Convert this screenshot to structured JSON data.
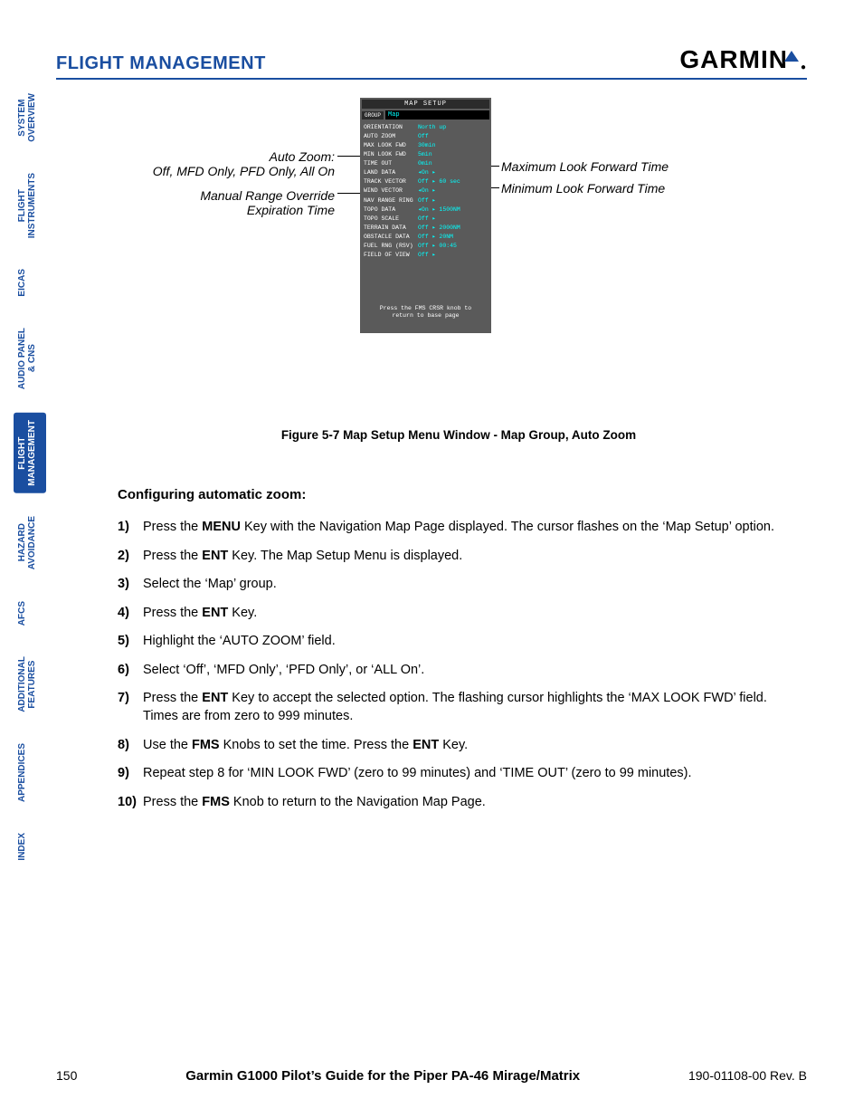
{
  "header": {
    "section_title": "FLIGHT MANAGEMENT",
    "logo_text": "GARMIN"
  },
  "sidebar": {
    "tabs": [
      "SYSTEM\nOVERVIEW",
      "FLIGHT\nINSTRUMENTS",
      "EICAS",
      "AUDIO PANEL\n& CNS",
      "FLIGHT\nMANAGEMENT",
      "HAZARD\nAVOIDANCE",
      "AFCS",
      "ADDITIONAL\nFEATURES",
      "APPENDICES",
      "INDEX"
    ],
    "active_index": 4
  },
  "figure": {
    "callouts": {
      "left1_a": "Auto Zoom:",
      "left1_b": "Off, MFD Only, PFD Only, All On",
      "left2_a": "Manual Range Override",
      "left2_b": "Expiration Time",
      "right1": "Maximum Look Forward Time",
      "right2": "Minimum Look Forward Time"
    },
    "map_setup": {
      "title": "MAP SETUP",
      "group_label": "GROUP",
      "group_value": "Map",
      "rows": [
        {
          "k": "ORIENTATION",
          "v": "North up"
        },
        {
          "k": "AUTO ZOOM",
          "v": "Off"
        },
        {
          "k": "MAX LOOK FWD",
          "v": "30min"
        },
        {
          "k": "MIN LOOK FWD",
          "v": "5min"
        },
        {
          "k": "TIME OUT",
          "v": "0min"
        },
        {
          "k": "LAND DATA",
          "v": "◂On ▸"
        },
        {
          "k": "TRACK VECTOR",
          "v": "Off ▸  60 sec"
        },
        {
          "k": "WIND VECTOR",
          "v": "◂On ▸"
        },
        {
          "k": "NAV RANGE RING",
          "v": "Off ▸"
        },
        {
          "k": "TOPO DATA",
          "v": "◂On ▸ 1500NM"
        },
        {
          "k": "TOPO SCALE",
          "v": "Off ▸"
        },
        {
          "k": "TERRAIN DATA",
          "v": "Off ▸ 2000NM"
        },
        {
          "k": "OBSTACLE DATA",
          "v": "Off ▸   20NM"
        },
        {
          "k": "FUEL RNG (RSV)",
          "v": "Off ▸  00:45"
        },
        {
          "k": "FIELD OF VIEW",
          "v": "Off ▸"
        }
      ],
      "footer_l1": "Press the FMS CRSR knob to",
      "footer_l2": "return to base page"
    },
    "caption": "Figure 5-7  Map Setup Menu Window - Map Group, Auto Zoom"
  },
  "content": {
    "subhead": "Configuring automatic zoom:",
    "steps_html": [
      "Press the <span class='b'>MENU</span> Key with the Navigation Map Page displayed.  The cursor flashes on the ‘Map Setup’ option.",
      "Press the <span class='b'>ENT</span> Key.  The Map Setup Menu is displayed.",
      "Select the ‘Map’ group.",
      "Press the <span class='b'>ENT</span> Key.",
      "Highlight the ‘AUTO ZOOM’ field.",
      "Select ‘Off’, ‘MFD Only’, ‘PFD Only’, or ‘ALL On’.",
      "Press the <span class='b'>ENT</span> Key to accept the selected option.  The flashing cursor highlights the ‘MAX LOOK FWD’ field.  Times are from zero to 999 minutes.",
      "Use the <span class='b'>FMS</span> Knobs to set the time.  Press the <span class='b'>ENT</span> Key.",
      "Repeat step 8 for ‘MIN LOOK FWD’ (zero to 99 minutes) and ‘TIME OUT’ (zero to 99 minutes).",
      "Press the <span class='b'>FMS</span> Knob to return to the Navigation Map Page."
    ]
  },
  "footer": {
    "page_number": "150",
    "center": "Garmin G1000 Pilot’s Guide for the Piper PA-46 Mirage/Matrix",
    "right": "190-01108-00   Rev. B"
  }
}
